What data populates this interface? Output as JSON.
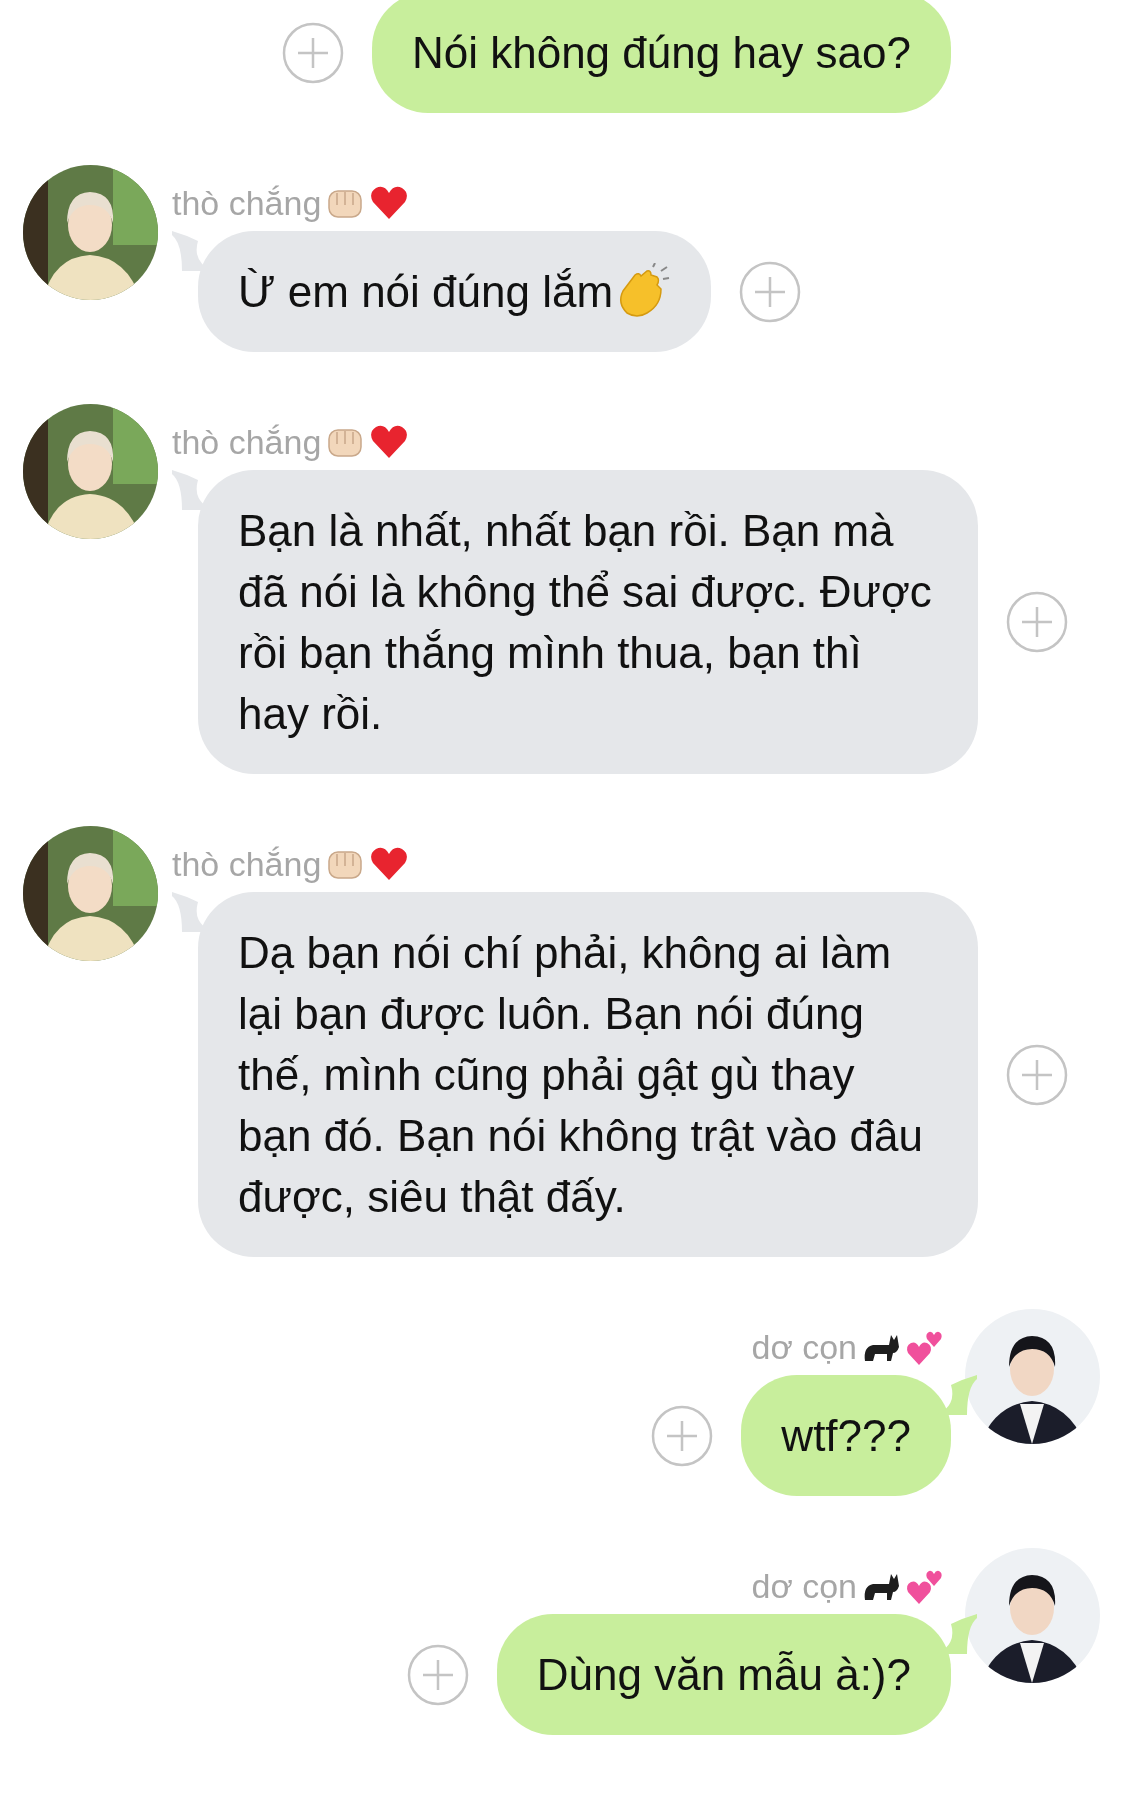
{
  "messages": [
    {
      "kind": "sent",
      "text": "Nói không đúng hay sao?"
    },
    {
      "kind": "received",
      "sender": "thò chắng",
      "badges": [
        {
          "kind": "fist"
        },
        {
          "kind": "heart"
        }
      ],
      "text": "Ừ em nói đúng lắm",
      "trailing_emoji": {
        "kind": "clap"
      }
    },
    {
      "kind": "received",
      "sender": "thò chắng",
      "badges": [
        {
          "kind": "fist"
        },
        {
          "kind": "heart"
        }
      ],
      "text": "Bạn là nhất, nhất bạn rồi. Bạn mà đã nói là không thể sai được. Được rồi bạn thắng mình thua, bạn thì hay rồi."
    },
    {
      "kind": "received",
      "sender": "thò chắng",
      "badges": [
        {
          "kind": "fist"
        },
        {
          "kind": "heart"
        }
      ],
      "text": "Dạ bạn nói chí phải, không ai làm lại bạn được luôn. Bạn nói đúng thế, mình cũng phải gật gù thay bạn đó. Bạn nói không trật vào đâu được, siêu thật đấy."
    },
    {
      "kind": "sent",
      "sender": "dơ cọn",
      "badges": [
        {
          "kind": "cat"
        },
        {
          "kind": "hearts"
        }
      ],
      "text": "wtf???"
    },
    {
      "kind": "sent",
      "sender": "dơ cọn",
      "badges": [
        {
          "kind": "cat"
        },
        {
          "kind": "hearts"
        }
      ],
      "text": "Dùng văn mẫu à:)?"
    }
  ]
}
